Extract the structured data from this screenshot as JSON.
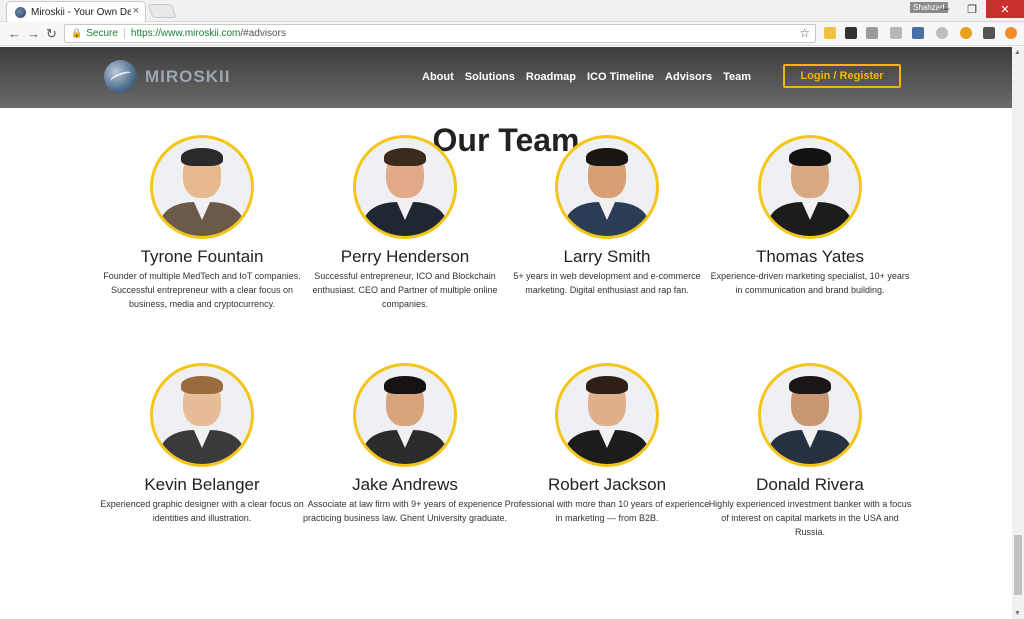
{
  "browser": {
    "tab_title": "Miroskii - Your Own Dec",
    "tab_close": "×",
    "profile": "Shahzad",
    "url_secure": "Secure",
    "url_proto": "https://www.miroskii.com",
    "url_path": "/#advisors"
  },
  "header": {
    "logo_text": "MIROSKII",
    "nav": [
      "About",
      "Solutions",
      "Roadmap",
      "ICO Timeline",
      "Advisors",
      "Team"
    ],
    "login_label": "Login / Register",
    "accent": "#f5b400"
  },
  "section": {
    "title": "Our Team"
  },
  "team": [
    {
      "name": "Tyrone Fountain",
      "bio": "Founder of multiple MedTech and IoT companies. Successful entrepreneur with a clear focus on business, media and cryptocurrency.",
      "skin": "#e6b98f",
      "hair": "#2b2a2a",
      "suit": "#6b5a49"
    },
    {
      "name": "Perry Henderson",
      "bio": "Successful entrepreneur, ICO and Blockchain enthusiast. CEO and Partner of multiple online companies.",
      "skin": "#e2a98a",
      "hair": "#3c2a1e",
      "suit": "#1f2733"
    },
    {
      "name": "Larry Smith",
      "bio": "5+ years in web development and e-commerce marketing. Digital enthusiast and rap fan.",
      "skin": "#d7a074",
      "hair": "#1a1412",
      "suit": "#2b3d55"
    },
    {
      "name": "Thomas Yates",
      "bio": "Experience-driven marketing specialist, 10+ years in communication and brand building.",
      "skin": "#d9a984",
      "hair": "#141112",
      "suit": "#1c1c1c"
    },
    {
      "name": "Kevin Belanger",
      "bio": "Experienced graphic designer with a clear focus on identities and illustration.",
      "skin": "#e7bc98",
      "hair": "#9a6b3d",
      "suit": "#3a3a3a"
    },
    {
      "name": "Jake Andrews",
      "bio": "Associate at law firm with 9+ years of experience practicing business law. Ghent University graduate.",
      "skin": "#d9a47b",
      "hair": "#161212",
      "suit": "#2b2b2b"
    },
    {
      "name": "Robert Jackson",
      "bio": "Professional with more than 10 years of experience in marketing — from B2B.",
      "skin": "#e0b08c",
      "hair": "#2e1f17",
      "suit": "#1c1c1c"
    },
    {
      "name": "Donald Rivera",
      "bio": "Highly experienced investment banker with a focus of interest on capital markets in the USA and Russia.",
      "skin": "#c99774",
      "hair": "#1b1615",
      "suit": "#263040"
    }
  ]
}
